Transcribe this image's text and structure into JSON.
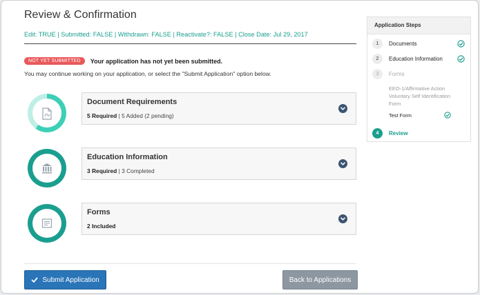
{
  "page": {
    "title": "Review & Confirmation",
    "status_line": "Edit: TRUE | Submitted: FALSE | Withdrawn: FALSE | Reactivate?: FALSE | Close Date: Jul 29, 2017"
  },
  "notice": {
    "badge": "NOT YET SUBMITTED",
    "message": "Your application has not yet been submitted.",
    "sub": "You may continue working on your application, or select the \"Submit Application\" option below."
  },
  "sections": [
    {
      "title": "Document Requirements",
      "sub_bold": "5 Required",
      "sub_rest": " | 5 Added (2 pending)",
      "icon": "pdf-document-icon",
      "progress": 0.6,
      "color": "#3ecfb7",
      "track": "#bfeee6"
    },
    {
      "title": "Education Information",
      "sub_bold": "3 Required",
      "sub_rest": " | 3 Completed",
      "icon": "institution-icon",
      "progress": 1.0,
      "color": "#1a9e8f",
      "track": "#1a9e8f"
    },
    {
      "title": "Forms",
      "sub_bold": "2 Included",
      "sub_rest": "",
      "icon": "form-icon",
      "progress": 1.0,
      "color": "#1a9e8f",
      "track": "#1a9e8f"
    }
  ],
  "actions": {
    "submit_label": "Submit Application",
    "back_label": "Back to Applications"
  },
  "steps": {
    "header": "Application Steps",
    "items": [
      {
        "num": "1",
        "label": "Documents",
        "checked": true
      },
      {
        "num": "2",
        "label": "Education Information",
        "checked": true
      },
      {
        "num": "3",
        "label": "Forms",
        "checked": false
      }
    ],
    "forms_sub": [
      {
        "label": "EEO-1/Affirmative Action Voluntary Self Identification Form",
        "checked": false
      },
      {
        "label": "Test Form",
        "checked": true
      }
    ],
    "current": {
      "num": "4",
      "label": "Review"
    }
  },
  "colors": {
    "accent": "#1a9e8f",
    "primary": "#2a74b8",
    "danger": "#e9585a",
    "secondary": "#8d97a2"
  }
}
